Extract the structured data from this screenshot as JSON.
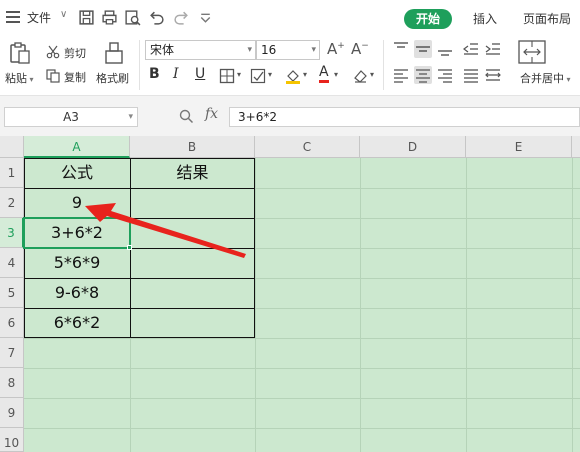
{
  "menu": {
    "file": "文件",
    "tabs": {
      "home": "开始",
      "insert": "插入",
      "layout": "页面布局"
    }
  },
  "ribbon": {
    "paste": "粘贴",
    "cut": "剪切",
    "copy": "复制",
    "format_painter": "格式刷",
    "font_name": "宋体",
    "font_size": "16",
    "merge_center": "合并居中"
  },
  "formula_bar": {
    "name_box": "A3",
    "fx": "fx",
    "formula": "3+6*2"
  },
  "sheet": {
    "columns": [
      "A",
      "B",
      "C",
      "D",
      "E"
    ],
    "rows": [
      "1",
      "2",
      "3",
      "4",
      "5",
      "6",
      "7",
      "8",
      "9",
      "10"
    ],
    "selected_cell": "A3",
    "cells": {
      "A1": "公式",
      "B1": "结果",
      "A2": "9",
      "A3": "3+6*2",
      "A4": "5*6*9",
      "A5": "9-6*8",
      "A6": "6*6*2"
    }
  },
  "colors": {
    "accent": "#1e9f5b",
    "sheet_background": "#cce8cf",
    "annotation_arrow": "#e8231d"
  }
}
